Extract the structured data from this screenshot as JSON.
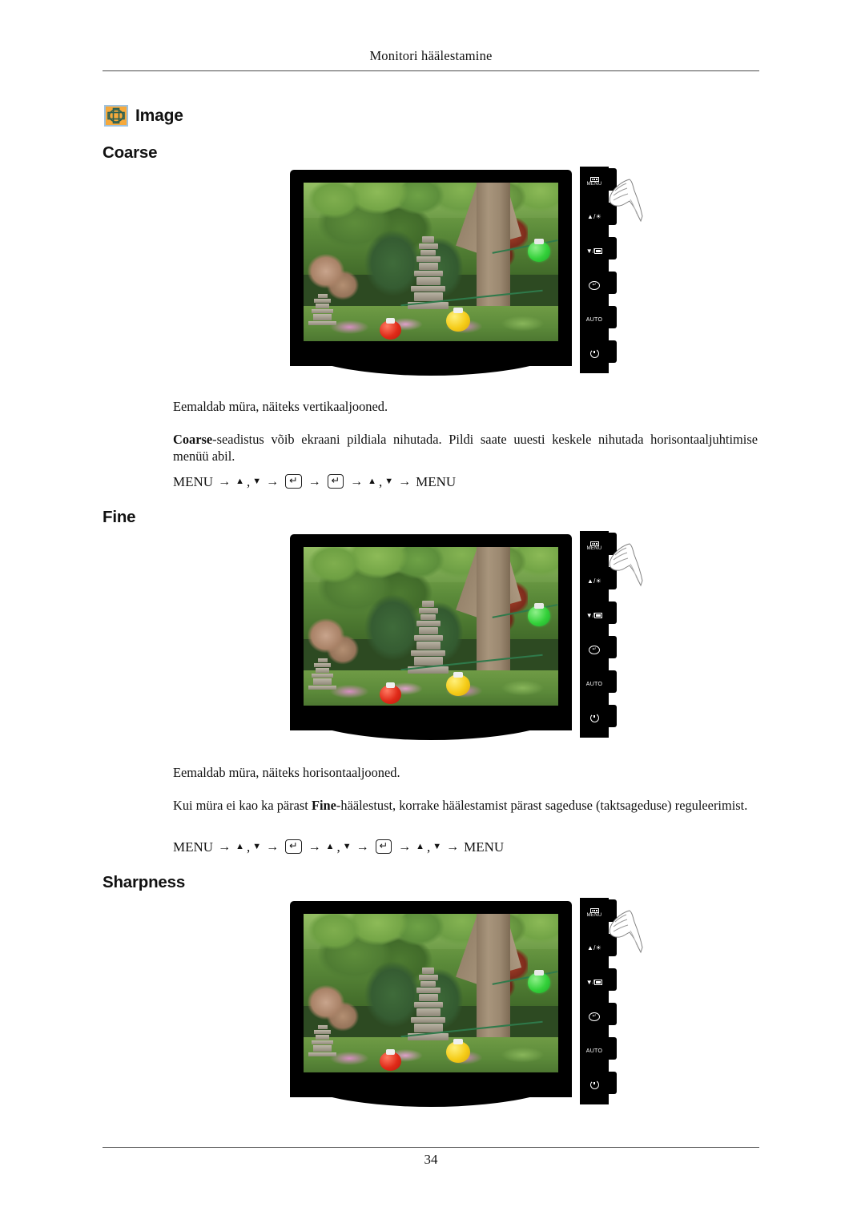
{
  "page": {
    "running_head": "Monitori häälestamine",
    "page_number": "34"
  },
  "section": {
    "icon": "image-monitor-icon",
    "title": "Image",
    "icon_colors": {
      "background": "#f6a93b",
      "border": "#9fc2de",
      "glyph": "#2a5f52"
    }
  },
  "subsections": [
    {
      "id": "coarse",
      "heading": "Coarse",
      "description": "Eemaldab müra, näiteks vertikaaljooned.",
      "note_bold": "Coarse",
      "note_rest": "-seadistus võib ekraani pildiala nihutada. Pildi saate uuesti keskele nihutada horisontaaljuhtimise menüü abil.",
      "menu_path_text": "MENU → ▲ , ▼ → ⏎ → ⏎ → ▲ , ▼ → MENU",
      "menu_path_tokens": [
        "MENU",
        "▲",
        "▼",
        "enter",
        "enter",
        "▲",
        "▼",
        "MENU"
      ]
    },
    {
      "id": "fine",
      "heading": "Fine",
      "description": "Eemaldab müra, näiteks horisontaaljooned.",
      "note_prefix": "Kui müra ei kao ka pärast ",
      "note_bold": "Fine",
      "note_rest": "-häälestust, korrake häälestamist pärast sageduse (taktsageduse) reguleerimist.",
      "menu_path_text": "MENU → ▲ , ▼ → ⏎ → ▲ , ▼ → ⏎ → ▲ , ▼ → MENU",
      "menu_path_tokens": [
        "MENU",
        "▲",
        "▼",
        "enter",
        "▲",
        "▼",
        "enter",
        "▲",
        "▼",
        "MENU"
      ]
    },
    {
      "id": "sharpness",
      "heading": "Sharpness"
    }
  ],
  "monitor_figure": {
    "screen_photo_alt": "Aia vaade kivipagoodi, puude ja värviliste laternatega",
    "panel_buttons": [
      {
        "name": "menu-button",
        "label": "MENU",
        "glyph": "menu-bars-icon"
      },
      {
        "name": "up-brightness-button",
        "label": "",
        "glyph": "▲/☀"
      },
      {
        "name": "down-source-button",
        "label": "",
        "glyph": "▼/▣"
      },
      {
        "name": "enter-button",
        "label": "",
        "glyph": "⏎"
      },
      {
        "name": "auto-button",
        "label": "AUTO",
        "glyph": ""
      },
      {
        "name": "power-button",
        "label": "",
        "glyph": "⏻"
      }
    ],
    "hand_cursor": "pointing-hand-icon"
  }
}
